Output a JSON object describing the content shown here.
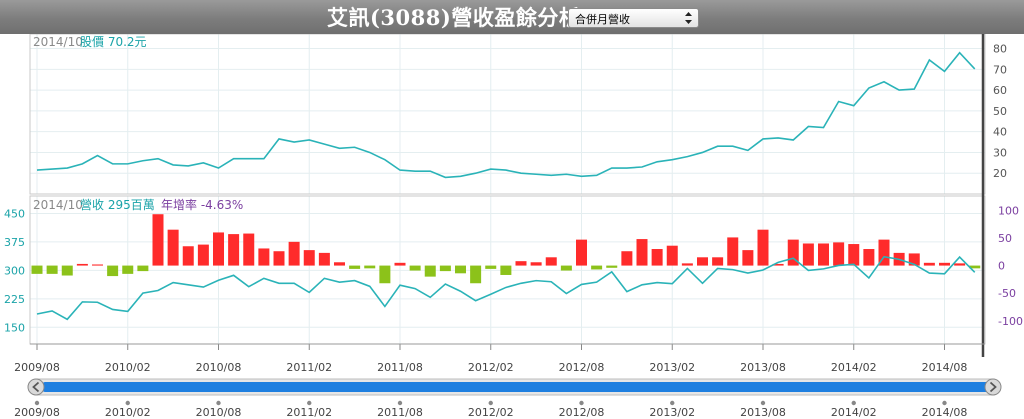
{
  "header": {
    "title": "艾訊(3088)營收盈餘分析",
    "select_value": "合併月營收"
  },
  "price_panel": {
    "date": "2014/10",
    "label": "股價 70.2元"
  },
  "revenue_panel": {
    "date": "2014/10",
    "label": "營收 295百萬",
    "yoy_label": "年增率 -4.63%"
  },
  "colors": {
    "price_line": "#2ab3b8",
    "revenue_line": "#2ab3b8",
    "bar_positive": "#ff2b2b",
    "bar_negative": "#8cc21a",
    "yoy_axis": "#7b3fa0",
    "scrollbar": "#1e7fe0"
  },
  "chart_data": [
    {
      "type": "line",
      "name": "price",
      "x": [
        "2009/08",
        "2009/09",
        "2009/10",
        "2009/11",
        "2009/12",
        "2010/01",
        "2010/02",
        "2010/03",
        "2010/04",
        "2010/05",
        "2010/06",
        "2010/07",
        "2010/08",
        "2010/09",
        "2010/10",
        "2010/11",
        "2010/12",
        "2011/01",
        "2011/02",
        "2011/03",
        "2011/04",
        "2011/05",
        "2011/06",
        "2011/07",
        "2011/08",
        "2011/09",
        "2011/10",
        "2011/11",
        "2011/12",
        "2012/01",
        "2012/02",
        "2012/03",
        "2012/04",
        "2012/05",
        "2012/06",
        "2012/07",
        "2012/08",
        "2012/09",
        "2012/10",
        "2012/11",
        "2012/12",
        "2013/01",
        "2013/02",
        "2013/03",
        "2013/04",
        "2013/05",
        "2013/06",
        "2013/07",
        "2013/08",
        "2013/09",
        "2013/10",
        "2013/11",
        "2013/12",
        "2014/01",
        "2014/02",
        "2014/03",
        "2014/04",
        "2014/05",
        "2014/06",
        "2014/07",
        "2014/08",
        "2014/09",
        "2014/10"
      ],
      "series": [
        {
          "values": [
            21.5,
            22,
            22.5,
            24.5,
            28.5,
            24.5,
            24.5,
            26,
            27,
            24,
            23.5,
            25,
            22.5,
            27,
            27,
            27,
            36.5,
            35,
            36,
            34,
            32,
            32.5,
            30,
            26.5,
            21.5,
            21,
            21,
            18,
            18.5,
            20,
            22,
            21.5,
            20,
            19.5,
            19,
            19.5,
            18.5,
            19,
            22.5,
            22.5,
            23,
            25.5,
            26.5,
            28,
            30,
            33,
            33,
            31,
            36.5,
            37,
            36,
            42.5,
            42,
            54.5,
            52.5,
            61,
            64,
            60,
            60.5,
            74.5,
            69,
            78,
            70.2
          ]
        }
      ],
      "yaxis_ticks": [
        20,
        30,
        40,
        50,
        60,
        70,
        80
      ],
      "ylim": [
        10,
        87
      ]
    },
    {
      "type": "bar",
      "name": "revenue",
      "x_ticks": [
        "2009/08",
        "2010/02",
        "2010/08",
        "2011/02",
        "2011/08",
        "2012/02",
        "2012/08",
        "2013/02",
        "2013/08",
        "2014/02",
        "2014/08"
      ],
      "left_axis_ticks": [
        150,
        225,
        300,
        375,
        450
      ],
      "right_axis_ticks": [
        -100,
        -50,
        0,
        50,
        100
      ],
      "revenue_ylim": [
        106,
        496
      ],
      "yoy_ylim": [
        -142,
        126
      ],
      "series": [
        {
          "name": "營收",
          "values": [
            185,
            193,
            171,
            217,
            216,
            197,
            192,
            240,
            247,
            268,
            262,
            256,
            274,
            287,
            257,
            279,
            266,
            266,
            242,
            279,
            269,
            273,
            258,
            205,
            261,
            252,
            229,
            264,
            245,
            220,
            237,
            255,
            266,
            273,
            270,
            239,
            263,
            269,
            296,
            244,
            262,
            268,
            265,
            305,
            266,
            305,
            302,
            293,
            301,
            321,
            332,
            300,
            304,
            313,
            316,
            280,
            336,
            329,
            316,
            293,
            291,
            335,
            295
          ]
        },
        {
          "name": "年增率",
          "values": [
            -15,
            -15,
            -18,
            3,
            2,
            -19,
            -15,
            -10,
            93,
            65,
            35,
            38,
            60,
            57,
            58,
            31,
            26,
            43,
            28,
            23,
            6,
            -6,
            -5,
            -32,
            5,
            -9,
            -20,
            -10,
            -14,
            -32,
            -6,
            -17,
            8,
            6,
            15,
            -9,
            47,
            -7,
            -4,
            26,
            48,
            30,
            36,
            4,
            15,
            15,
            51,
            28,
            65,
            3,
            47,
            40,
            40,
            42,
            39,
            30,
            47,
            23,
            22,
            5,
            5,
            4,
            -5
          ]
        }
      ]
    }
  ],
  "navigator": {
    "labels": [
      "2009/08",
      "2010/02",
      "2010/08",
      "2011/02",
      "2011/08",
      "2012/02",
      "2012/08",
      "2013/02",
      "2013/08",
      "2014/02",
      "2014/08"
    ]
  }
}
